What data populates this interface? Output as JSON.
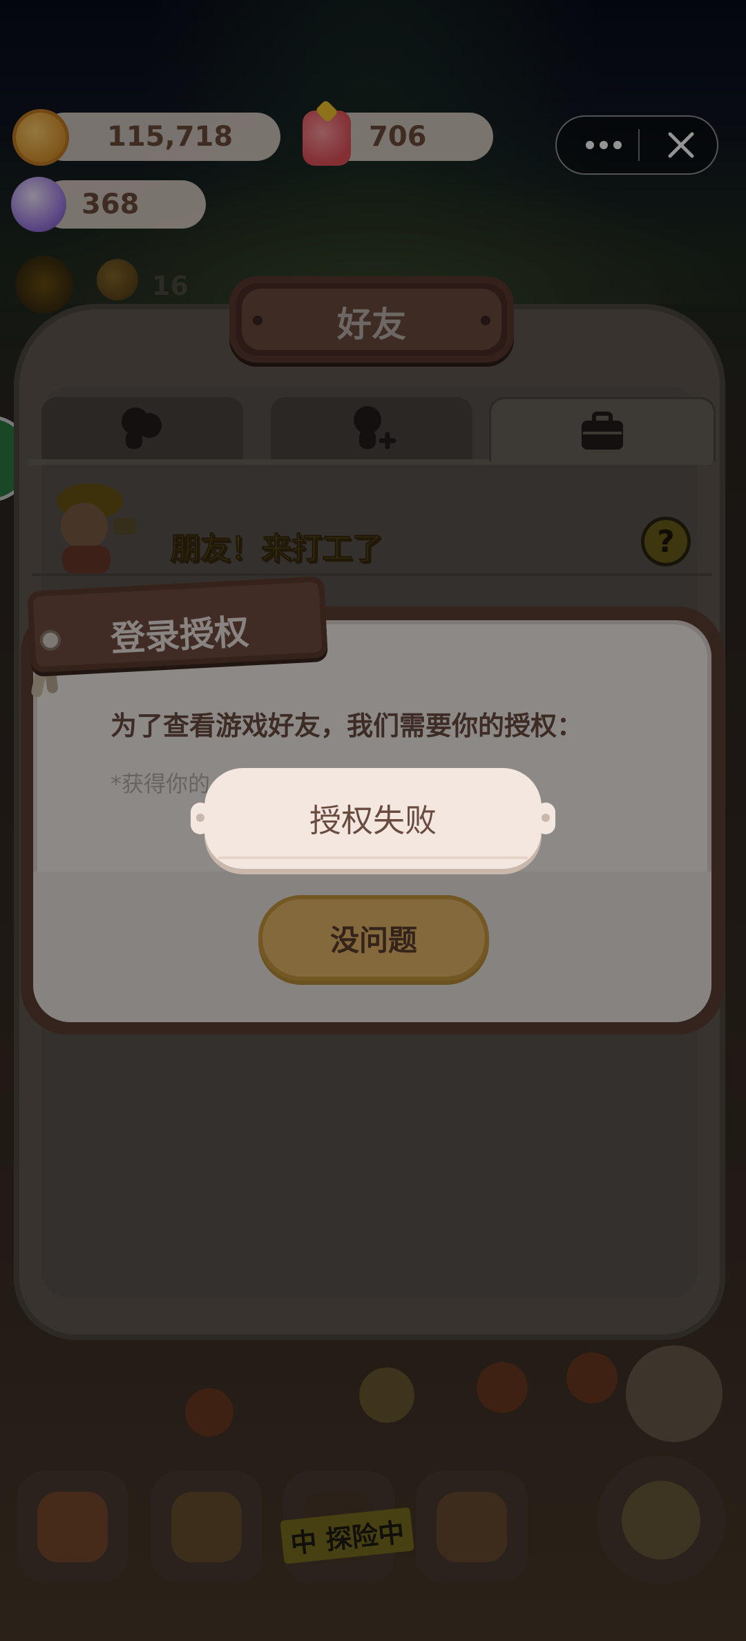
{
  "currency": {
    "coins": "115,718",
    "gems": "706",
    "candies": "368"
  },
  "hud": {
    "count": "16"
  },
  "capsule": {
    "more_icon": "more-dots-icon",
    "close_icon": "close-icon"
  },
  "panel": {
    "title": "好友",
    "tabs": [
      {
        "icon": "friends-icon"
      },
      {
        "icon": "add-friend-icon"
      },
      {
        "icon": "briefcase-icon"
      }
    ],
    "banner_text": "朋友！来打工了",
    "help_label": "?"
  },
  "dialog": {
    "tag_title": "登录授权",
    "message": "为了查看游戏好友，我们需要你的授权：",
    "note": "*获得你的",
    "ok_label": "没问题"
  },
  "toast": {
    "text": "授权失败"
  },
  "bottom_nav": {
    "explore_label": "中 探险中"
  },
  "colors": {
    "dialog_bg": "#f2ece8",
    "ok_button": "#e2b667",
    "brown_text": "#6a4b41",
    "panel": "#625952"
  }
}
